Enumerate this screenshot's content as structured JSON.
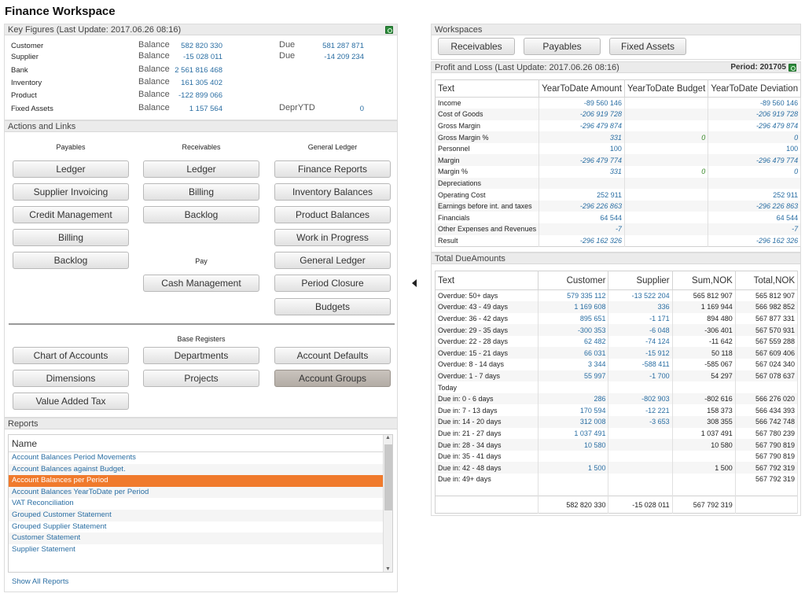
{
  "title": "Finance Workspace",
  "key_figures": {
    "header": "Key Figures (Last Update: 2017.06.26 08:16)",
    "rows": [
      {
        "label": "Customer",
        "word": "Balance",
        "value": "582 820 330",
        "word2": "Due",
        "value2": "581 287 871"
      },
      {
        "label": "Supplier",
        "word": "Balance",
        "value": "-15 028 011",
        "word2": "Due",
        "value2": "-14 209 234"
      },
      {
        "label": "Bank",
        "word": "Balance",
        "value": "2 561 816 468",
        "word2": "",
        "value2": ""
      },
      {
        "label": "Inventory",
        "word": "Balance",
        "value": "161 305 402",
        "word2": "",
        "value2": ""
      },
      {
        "label": "Product",
        "word": "Balance",
        "value": "-122 899 066",
        "word2": "",
        "value2": ""
      },
      {
        "label": "Fixed Assets",
        "word": "Balance",
        "value": "1 157 564",
        "word2": "DeprYTD",
        "value2": "0"
      }
    ]
  },
  "actions": {
    "header": "Actions and Links",
    "payables_title": "Payables",
    "receivables_title": "Receivables",
    "gl_title": "General Ledger",
    "pay_title": "Pay",
    "payables": [
      "Ledger",
      "Supplier Invoicing",
      "Credit Management",
      "Billing",
      "Backlog"
    ],
    "receivables": [
      "Ledger",
      "Billing",
      "Backlog"
    ],
    "pay": [
      "Cash Management"
    ],
    "general_ledger": [
      "Finance Reports",
      "Inventory Balances",
      "Product Balances",
      "Work in Progress",
      "General Ledger",
      "Period Closure",
      "Budgets"
    ],
    "base_title": "Base Registers",
    "base": [
      "Chart of Accounts",
      "Departments",
      "Account Defaults",
      "Dimensions",
      "Projects",
      "Account Groups",
      "Value Added Tax"
    ]
  },
  "reports": {
    "header": "Reports",
    "column": "Name",
    "items": [
      "Account Balances Period Movements",
      "Account Balances against Budget.",
      "Account Balances per Period",
      "Account Balances YearToDate per Period",
      "VAT Reconciliation",
      "Grouped Customer Statement",
      "Grouped Supplier Statement",
      "Customer Statement",
      "Supplier Statement"
    ],
    "selected_index": 2,
    "show_all": "Show All Reports"
  },
  "workspaces": {
    "header": "Workspaces",
    "buttons": [
      "Receivables",
      "Payables",
      "Fixed Assets"
    ]
  },
  "pl": {
    "header": "Profit and Loss (Last Update: 2017.06.26 08:16)",
    "period_label": "Period:",
    "period_value": "201705",
    "columns": [
      "Text",
      "YearToDate Amount",
      "YearToDate Budget",
      "YearToDate Deviation"
    ],
    "rows": [
      {
        "text": "Income",
        "amount": "-89 560 146",
        "budget": "",
        "deviation": "-89 560 146"
      },
      {
        "text": "Cost of Goods",
        "amount": "-206 919 728",
        "budget": "",
        "deviation": "-206 919 728"
      },
      {
        "text": "Gross Margin",
        "amount": "-296 479 874",
        "budget": "",
        "deviation": "-296 479 874"
      },
      {
        "text": "Gross Margin %",
        "amount": "331",
        "budget": "0",
        "deviation": "0"
      },
      {
        "text": "Personnel",
        "amount": "100",
        "budget": "",
        "deviation": "100"
      },
      {
        "text": "Margin",
        "amount": "-296 479 774",
        "budget": "",
        "deviation": "-296 479 774"
      },
      {
        "text": "Margin %",
        "amount": "331",
        "budget": "0",
        "deviation": "0"
      },
      {
        "text": "Depreciations",
        "amount": "",
        "budget": "",
        "deviation": ""
      },
      {
        "text": "Operating Cost",
        "amount": "252 911",
        "budget": "",
        "deviation": "252 911"
      },
      {
        "text": "Earnings before int. and taxes",
        "amount": "-296 226 863",
        "budget": "",
        "deviation": "-296 226 863"
      },
      {
        "text": "Financials",
        "amount": "64 544",
        "budget": "",
        "deviation": "64 544"
      },
      {
        "text": "Other Expenses and Revenues",
        "amount": "-7",
        "budget": "",
        "deviation": "-7"
      },
      {
        "text": "Result",
        "amount": "-296 162 326",
        "budget": "",
        "deviation": "-296 162 326"
      }
    ]
  },
  "due": {
    "header": "Total DueAmounts",
    "columns": [
      "Text",
      "Customer",
      "Supplier",
      "Sum,NOK",
      "Total,NOK"
    ],
    "rows": [
      {
        "text": "Overdue: 50+ days",
        "customer": "579 335 112",
        "supplier": "-13 522 204",
        "sum": "565 812 907",
        "total": "565 812 907"
      },
      {
        "text": "Overdue: 43 - 49 days",
        "customer": "1 169 608",
        "supplier": "336",
        "sum": "1 169 944",
        "total": "566 982 852"
      },
      {
        "text": "Overdue: 36 - 42 days",
        "customer": "895 651",
        "supplier": "-1 171",
        "sum": "894 480",
        "total": "567 877 331"
      },
      {
        "text": "Overdue: 29 - 35 days",
        "customer": "-300 353",
        "supplier": "-6 048",
        "sum": "-306 401",
        "total": "567 570 931"
      },
      {
        "text": "Overdue: 22 - 28 days",
        "customer": "62 482",
        "supplier": "-74 124",
        "sum": "-11 642",
        "total": "567 559 288"
      },
      {
        "text": "Overdue: 15 - 21 days",
        "customer": "66 031",
        "supplier": "-15 912",
        "sum": "50 118",
        "total": "567 609 406"
      },
      {
        "text": "Overdue: 8 - 14 days",
        "customer": "3 344",
        "supplier": "-588 411",
        "sum": "-585 067",
        "total": "567 024 340"
      },
      {
        "text": "Overdue: 1 - 7 days",
        "customer": "55 997",
        "supplier": "-1 700",
        "sum": "54 297",
        "total": "567 078 637"
      },
      {
        "text": "Today",
        "customer": "",
        "supplier": "",
        "sum": "",
        "total": ""
      },
      {
        "text": "Due in: 0 - 6 days",
        "customer": "286",
        "supplier": "-802 903",
        "sum": "-802 616",
        "total": "566 276 020"
      },
      {
        "text": "Due in: 7 - 13 days",
        "customer": "170 594",
        "supplier": "-12 221",
        "sum": "158 373",
        "total": "566 434 393"
      },
      {
        "text": "Due in: 14 - 20 days",
        "customer": "312 008",
        "supplier": "-3 653",
        "sum": "308 355",
        "total": "566 742 748"
      },
      {
        "text": "Due in: 21 - 27 days",
        "customer": "1 037 491",
        "supplier": "",
        "sum": "1 037 491",
        "total": "567 780 239"
      },
      {
        "text": "Due in: 28 - 34 days",
        "customer": "10 580",
        "supplier": "",
        "sum": "10 580",
        "total": "567 790 819"
      },
      {
        "text": "Due in: 35 - 41 days",
        "customer": "",
        "supplier": "",
        "sum": "",
        "total": "567 790 819"
      },
      {
        "text": "Due in: 42 - 48 days",
        "customer": "1 500",
        "supplier": "",
        "sum": "1 500",
        "total": "567 792 319"
      },
      {
        "text": "Due in: 49+ days",
        "customer": "",
        "supplier": "",
        "sum": "",
        "total": "567 792 319"
      }
    ],
    "totals": {
      "customer": "582 820 330",
      "supplier": "-15 028 011",
      "sum": "567 792 319",
      "total": ""
    }
  },
  "icons": {
    "excel": "excel-icon",
    "collapse": "collapse-left-icon"
  }
}
